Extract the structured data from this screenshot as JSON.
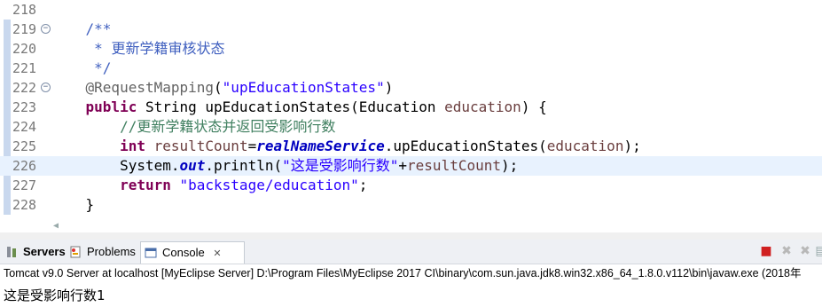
{
  "editor": {
    "lines": [
      {
        "n": "218",
        "fold": false,
        "current": false,
        "indent": "",
        "parts": []
      },
      {
        "n": "219",
        "fold": true,
        "current": false,
        "indent": "    ",
        "parts": [
          {
            "c": "jdoc",
            "t": "/**"
          }
        ]
      },
      {
        "n": "220",
        "fold": false,
        "current": false,
        "indent": "     ",
        "parts": [
          {
            "c": "jdoc",
            "t": "* 更新学籍审核状态"
          }
        ]
      },
      {
        "n": "221",
        "fold": false,
        "current": false,
        "indent": "     ",
        "parts": [
          {
            "c": "jdoc",
            "t": "*/"
          }
        ]
      },
      {
        "n": "222",
        "fold": true,
        "current": false,
        "indent": "    ",
        "parts": [
          {
            "c": "ann",
            "t": "@RequestMapping"
          },
          {
            "c": "dflt",
            "t": "("
          },
          {
            "c": "str",
            "t": "\"upEducationStates\""
          },
          {
            "c": "dflt",
            "t": ")"
          }
        ]
      },
      {
        "n": "223",
        "fold": false,
        "current": false,
        "indent": "    ",
        "parts": [
          {
            "c": "kw",
            "t": "public"
          },
          {
            "c": "dflt",
            "t": " String upEducationStates(Education "
          },
          {
            "c": "param",
            "t": "education"
          },
          {
            "c": "dflt",
            "t": ") {"
          }
        ]
      },
      {
        "n": "224",
        "fold": false,
        "current": false,
        "indent": "        ",
        "parts": [
          {
            "c": "cmt",
            "t": "//更新学籍状态并返回受影响行数"
          }
        ]
      },
      {
        "n": "225",
        "fold": false,
        "current": false,
        "indent": "        ",
        "parts": [
          {
            "c": "kw",
            "t": "int"
          },
          {
            "c": "dflt",
            "t": " "
          },
          {
            "c": "param",
            "t": "resultCount"
          },
          {
            "c": "dflt",
            "t": "="
          },
          {
            "c": "field",
            "t": "realNameService"
          },
          {
            "c": "dflt",
            "t": ".upEducationStates("
          },
          {
            "c": "param",
            "t": "education"
          },
          {
            "c": "dflt",
            "t": ");"
          }
        ]
      },
      {
        "n": "226",
        "fold": false,
        "current": true,
        "indent": "        ",
        "parts": [
          {
            "c": "dflt",
            "t": "System."
          },
          {
            "c": "field",
            "t": "out"
          },
          {
            "c": "dflt",
            "t": ".println("
          },
          {
            "c": "str",
            "t": "\"这是受影响行数\""
          },
          {
            "c": "dflt",
            "t": "+"
          },
          {
            "c": "param",
            "t": "resultCount"
          },
          {
            "c": "dflt",
            "t": ");"
          }
        ]
      },
      {
        "n": "227",
        "fold": false,
        "current": false,
        "indent": "        ",
        "parts": [
          {
            "c": "kw",
            "t": "return"
          },
          {
            "c": "dflt",
            "t": " "
          },
          {
            "c": "str",
            "t": "\"backstage/education\""
          },
          {
            "c": "dflt",
            "t": ";"
          }
        ]
      },
      {
        "n": "228",
        "fold": false,
        "current": false,
        "indent": "    ",
        "parts": [
          {
            "c": "dflt",
            "t": "}"
          }
        ]
      }
    ]
  },
  "tabs": {
    "servers_label": "Servers",
    "problems_label": "Problems",
    "console_label": "Console",
    "console_close": "✕"
  },
  "icons": {
    "servers": "servers-icon",
    "problems": "problems-icon",
    "console": "console-icon",
    "terminate": "terminate-icon",
    "remove": "remove-launch-icon",
    "remove_all": "remove-all-icon",
    "clear": "clear-console-icon"
  },
  "console": {
    "status": "Tomcat v9.0 Server at localhost [MyEclipse Server] D:\\Program Files\\MyEclipse 2017 CI\\binary\\com.sun.java.jdk8.win32.x86_64_1.8.0.v112\\bin\\javaw.exe (2018年",
    "output": "这是受影响行数1"
  },
  "colors": {
    "keyword": "#7f0055",
    "comment": "#3f7f5f",
    "javadoc": "#3f5fbf",
    "string": "#2a00ff",
    "field": "#0000c0",
    "variable": "#6a3e3e",
    "current_line": "#e8f2fe"
  }
}
